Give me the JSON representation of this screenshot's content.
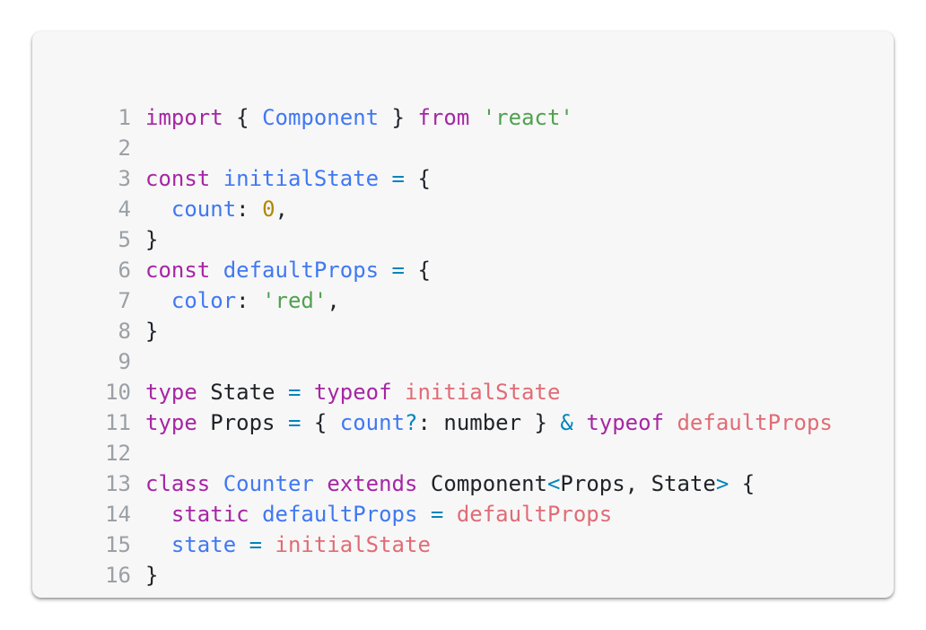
{
  "code": {
    "lines": [
      {
        "n": "1",
        "tokens": [
          {
            "t": "import",
            "c": "kw"
          },
          {
            "t": " { ",
            "c": "pl"
          },
          {
            "t": "Component",
            "c": "id"
          },
          {
            "t": " } ",
            "c": "pl"
          },
          {
            "t": "from",
            "c": "kw"
          },
          {
            "t": " ",
            "c": "pl"
          },
          {
            "t": "'react'",
            "c": "str"
          }
        ]
      },
      {
        "n": "2",
        "tokens": []
      },
      {
        "n": "3",
        "tokens": [
          {
            "t": "const",
            "c": "kw"
          },
          {
            "t": " ",
            "c": "pl"
          },
          {
            "t": "initialState",
            "c": "id"
          },
          {
            "t": " ",
            "c": "pl"
          },
          {
            "t": "=",
            "c": "op"
          },
          {
            "t": " {",
            "c": "pl"
          }
        ]
      },
      {
        "n": "4",
        "tokens": [
          {
            "t": "  ",
            "c": "pl"
          },
          {
            "t": "count",
            "c": "id"
          },
          {
            "t": ": ",
            "c": "pl"
          },
          {
            "t": "0",
            "c": "num"
          },
          {
            "t": ",",
            "c": "pl"
          }
        ]
      },
      {
        "n": "5",
        "tokens": [
          {
            "t": "}",
            "c": "pl"
          }
        ]
      },
      {
        "n": "6",
        "tokens": [
          {
            "t": "const",
            "c": "kw"
          },
          {
            "t": " ",
            "c": "pl"
          },
          {
            "t": "defaultProps",
            "c": "id"
          },
          {
            "t": " ",
            "c": "pl"
          },
          {
            "t": "=",
            "c": "op"
          },
          {
            "t": " {",
            "c": "pl"
          }
        ]
      },
      {
        "n": "7",
        "tokens": [
          {
            "t": "  ",
            "c": "pl"
          },
          {
            "t": "color",
            "c": "id"
          },
          {
            "t": ": ",
            "c": "pl"
          },
          {
            "t": "'red'",
            "c": "str"
          },
          {
            "t": ",",
            "c": "pl"
          }
        ]
      },
      {
        "n": "8",
        "tokens": [
          {
            "t": "}",
            "c": "pl"
          }
        ]
      },
      {
        "n": "9",
        "tokens": []
      },
      {
        "n": "10",
        "tokens": [
          {
            "t": "type",
            "c": "kw"
          },
          {
            "t": " State ",
            "c": "pl"
          },
          {
            "t": "=",
            "c": "op"
          },
          {
            "t": " ",
            "c": "pl"
          },
          {
            "t": "typeof",
            "c": "kw"
          },
          {
            "t": " ",
            "c": "pl"
          },
          {
            "t": "initialState",
            "c": "ref"
          }
        ]
      },
      {
        "n": "11",
        "tokens": [
          {
            "t": "type",
            "c": "kw"
          },
          {
            "t": " Props ",
            "c": "pl"
          },
          {
            "t": "=",
            "c": "op"
          },
          {
            "t": " { ",
            "c": "pl"
          },
          {
            "t": "count",
            "c": "id"
          },
          {
            "t": "?",
            "c": "op"
          },
          {
            "t": ": number } ",
            "c": "pl"
          },
          {
            "t": "&",
            "c": "op"
          },
          {
            "t": " ",
            "c": "pl"
          },
          {
            "t": "typeof",
            "c": "kw"
          },
          {
            "t": " ",
            "c": "pl"
          },
          {
            "t": "defaultProps",
            "c": "ref"
          }
        ]
      },
      {
        "n": "12",
        "tokens": []
      },
      {
        "n": "13",
        "tokens": [
          {
            "t": "class",
            "c": "kw"
          },
          {
            "t": " ",
            "c": "pl"
          },
          {
            "t": "Counter",
            "c": "id"
          },
          {
            "t": " ",
            "c": "pl"
          },
          {
            "t": "extends",
            "c": "kw"
          },
          {
            "t": " Component",
            "c": "pl"
          },
          {
            "t": "<",
            "c": "op"
          },
          {
            "t": "Props, State",
            "c": "pl"
          },
          {
            "t": ">",
            "c": "op"
          },
          {
            "t": " {",
            "c": "pl"
          }
        ]
      },
      {
        "n": "14",
        "tokens": [
          {
            "t": "  ",
            "c": "pl"
          },
          {
            "t": "static",
            "c": "kw"
          },
          {
            "t": " ",
            "c": "pl"
          },
          {
            "t": "defaultProps",
            "c": "id"
          },
          {
            "t": " ",
            "c": "pl"
          },
          {
            "t": "=",
            "c": "op"
          },
          {
            "t": " ",
            "c": "pl"
          },
          {
            "t": "defaultProps",
            "c": "ref"
          }
        ]
      },
      {
        "n": "15",
        "tokens": [
          {
            "t": "  ",
            "c": "pl"
          },
          {
            "t": "state",
            "c": "id"
          },
          {
            "t": " ",
            "c": "pl"
          },
          {
            "t": "=",
            "c": "op"
          },
          {
            "t": " ",
            "c": "pl"
          },
          {
            "t": "initialState",
            "c": "ref"
          }
        ]
      },
      {
        "n": "16",
        "tokens": [
          {
            "t": "}",
            "c": "pl"
          }
        ]
      }
    ]
  }
}
